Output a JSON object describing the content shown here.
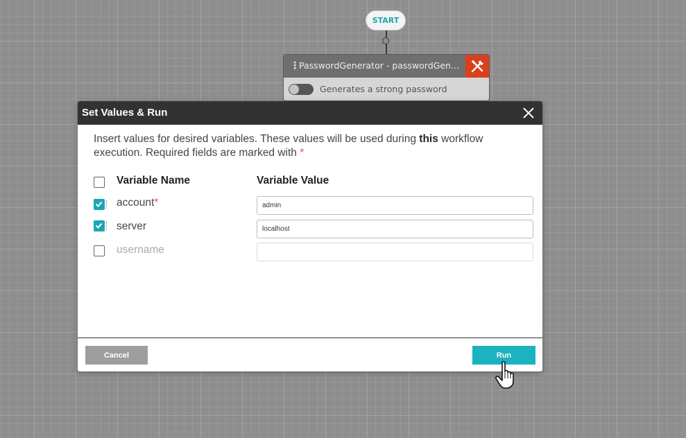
{
  "canvas": {
    "start_label": "START",
    "task_node": {
      "title": "PasswordGenerator - passwordGen...",
      "description": "Generates a strong password",
      "menu_icon": "vertical-dots-icon",
      "tool_icon": "wrench-screwdriver-icon",
      "tool_color": "#d9411e"
    }
  },
  "dialog": {
    "title": "Set Values & Run",
    "close_icon": "close-icon",
    "intro_before": "Insert values for desired variables. These values will be used during ",
    "intro_bold": "this",
    "intro_after": " workflow execution. Required fields are marked with ",
    "required_marker": "*",
    "columns": {
      "name": "Variable Name",
      "value": "Variable Value"
    },
    "variables": [
      {
        "name": "account",
        "required": true,
        "checked": true,
        "value": "admin"
      },
      {
        "name": "server",
        "required": false,
        "checked": true,
        "value": "localhost"
      },
      {
        "name": "username",
        "required": false,
        "checked": false,
        "value": ""
      }
    ],
    "cancel_label": "Cancel",
    "run_label": "Run",
    "accent_color": "#1ab3bf"
  }
}
